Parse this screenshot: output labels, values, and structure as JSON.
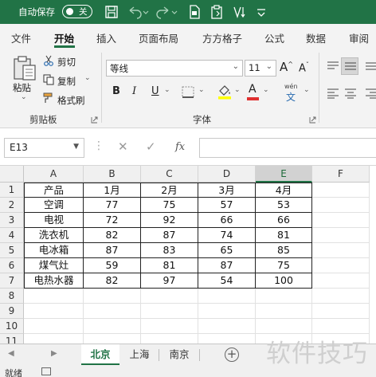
{
  "titlebar": {
    "autosave_label": "自动保存",
    "autosave_state": "关"
  },
  "ribbon_tabs": [
    "文件",
    "开始",
    "插入",
    "页面布局",
    "方方格子",
    "公式",
    "数据",
    "审阅"
  ],
  "active_tab": "开始",
  "clipboard": {
    "paste": "粘贴",
    "cut": "剪切",
    "copy": "复制",
    "format_painter": "格式刷",
    "group_label": "剪贴板"
  },
  "font": {
    "name": "等线",
    "size": "11",
    "group_label": "字体",
    "bold": "B",
    "italic": "I",
    "underline": "U",
    "grow": "A",
    "shrink": "A",
    "wen": "wén",
    "wen_char": "文",
    "fill_color": "#ffff00",
    "font_color": "#e03030"
  },
  "formula_bar": {
    "name_box": "E13",
    "fx": "fx",
    "value": ""
  },
  "columns": [
    "A",
    "B",
    "C",
    "D",
    "E",
    "F"
  ],
  "selected_column": "E",
  "rows": [
    "1",
    "2",
    "3",
    "4",
    "5",
    "6",
    "7",
    "8",
    "9",
    "10",
    "11"
  ],
  "table": {
    "header": [
      "产品",
      "1月",
      "2月",
      "3月",
      "4月"
    ],
    "rows": [
      [
        "空调",
        "77",
        "75",
        "57",
        "53"
      ],
      [
        "电视",
        "72",
        "92",
        "66",
        "66"
      ],
      [
        "洗衣机",
        "82",
        "87",
        "74",
        "81"
      ],
      [
        "电冰箱",
        "87",
        "83",
        "65",
        "85"
      ],
      [
        "煤气灶",
        "59",
        "81",
        "87",
        "75"
      ],
      [
        "电热水器",
        "82",
        "97",
        "54",
        "100"
      ]
    ]
  },
  "sheets": [
    "北京",
    "上海",
    "南京"
  ],
  "active_sheet": "北京",
  "status": "就绪",
  "watermark": "软件技巧"
}
